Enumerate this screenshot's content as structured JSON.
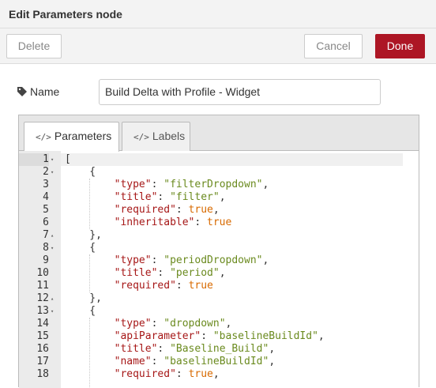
{
  "dialog": {
    "title": "Edit Parameters node"
  },
  "toolbar": {
    "delete_label": "Delete",
    "cancel_label": "Cancel",
    "done_label": "Done"
  },
  "name_field": {
    "label": "Name",
    "icon": "tag-icon",
    "value": "Build Delta with Profile - Widget"
  },
  "tabs": [
    {
      "label": "Parameters",
      "icon": "code-icon",
      "active": true
    },
    {
      "label": "Labels",
      "icon": "code-icon",
      "active": false
    }
  ],
  "editor": {
    "active_line": 1,
    "lines": [
      {
        "num": "1",
        "fold": "▾",
        "tokens": [
          [
            "p",
            "["
          ]
        ]
      },
      {
        "num": "2",
        "fold": "▾",
        "tokens": [
          [
            "p",
            "    {"
          ]
        ]
      },
      {
        "num": "3",
        "fold": "",
        "tokens": [
          [
            "p",
            "        "
          ],
          [
            "k",
            "\"type\""
          ],
          [
            "p",
            ": "
          ],
          [
            "s",
            "\"filterDropdown\""
          ],
          [
            "p",
            ","
          ]
        ]
      },
      {
        "num": "4",
        "fold": "",
        "tokens": [
          [
            "p",
            "        "
          ],
          [
            "k",
            "\"title\""
          ],
          [
            "p",
            ": "
          ],
          [
            "s",
            "\"filter\""
          ],
          [
            "p",
            ","
          ]
        ]
      },
      {
        "num": "5",
        "fold": "",
        "tokens": [
          [
            "p",
            "        "
          ],
          [
            "k",
            "\"required\""
          ],
          [
            "p",
            ": "
          ],
          [
            "b",
            "true"
          ],
          [
            "p",
            ","
          ]
        ]
      },
      {
        "num": "6",
        "fold": "",
        "tokens": [
          [
            "p",
            "        "
          ],
          [
            "k",
            "\"inheritable\""
          ],
          [
            "p",
            ": "
          ],
          [
            "b",
            "true"
          ]
        ]
      },
      {
        "num": "7",
        "fold": "▴",
        "tokens": [
          [
            "p",
            "    },"
          ]
        ]
      },
      {
        "num": "8",
        "fold": "▾",
        "tokens": [
          [
            "p",
            "    {"
          ]
        ]
      },
      {
        "num": "9",
        "fold": "",
        "tokens": [
          [
            "p",
            "        "
          ],
          [
            "k",
            "\"type\""
          ],
          [
            "p",
            ": "
          ],
          [
            "s",
            "\"periodDropdown\""
          ],
          [
            "p",
            ","
          ]
        ]
      },
      {
        "num": "10",
        "fold": "",
        "tokens": [
          [
            "p",
            "        "
          ],
          [
            "k",
            "\"title\""
          ],
          [
            "p",
            ": "
          ],
          [
            "s",
            "\"period\""
          ],
          [
            "p",
            ","
          ]
        ]
      },
      {
        "num": "11",
        "fold": "",
        "tokens": [
          [
            "p",
            "        "
          ],
          [
            "k",
            "\"required\""
          ],
          [
            "p",
            ": "
          ],
          [
            "b",
            "true"
          ]
        ]
      },
      {
        "num": "12",
        "fold": "▴",
        "tokens": [
          [
            "p",
            "    },"
          ]
        ]
      },
      {
        "num": "13",
        "fold": "▾",
        "tokens": [
          [
            "p",
            "    {"
          ]
        ]
      },
      {
        "num": "14",
        "fold": "",
        "tokens": [
          [
            "p",
            "        "
          ],
          [
            "k",
            "\"type\""
          ],
          [
            "p",
            ": "
          ],
          [
            "s",
            "\"dropdown\""
          ],
          [
            "p",
            ","
          ]
        ]
      },
      {
        "num": "15",
        "fold": "",
        "tokens": [
          [
            "p",
            "        "
          ],
          [
            "k",
            "\"apiParameter\""
          ],
          [
            "p",
            ": "
          ],
          [
            "s",
            "\"baselineBuildId\""
          ],
          [
            "p",
            ","
          ]
        ]
      },
      {
        "num": "16",
        "fold": "",
        "tokens": [
          [
            "p",
            "        "
          ],
          [
            "k",
            "\"title\""
          ],
          [
            "p",
            ": "
          ],
          [
            "s",
            "\"Baseline_Build\""
          ],
          [
            "p",
            ","
          ]
        ]
      },
      {
        "num": "17",
        "fold": "",
        "tokens": [
          [
            "p",
            "        "
          ],
          [
            "k",
            "\"name\""
          ],
          [
            "p",
            ": "
          ],
          [
            "s",
            "\"baselineBuildId\""
          ],
          [
            "p",
            ","
          ]
        ]
      },
      {
        "num": "18",
        "fold": "",
        "tokens": [
          [
            "p",
            "        "
          ],
          [
            "k",
            "\"required\""
          ],
          [
            "p",
            ": "
          ],
          [
            "b",
            "true"
          ],
          [
            "p",
            ","
          ]
        ]
      }
    ]
  }
}
